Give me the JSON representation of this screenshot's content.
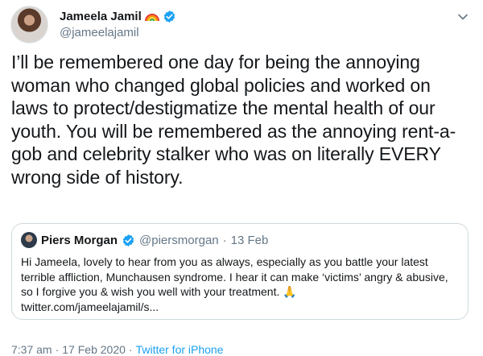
{
  "author": {
    "name": "Jameela Jamil",
    "handle": "@jameelajamil",
    "badge_icon": "rainbow-icon",
    "verified_color": "#1da1f2"
  },
  "tweet": {
    "text": "I’ll be remembered one day for being the annoying woman who changed global policies and worked on laws to protect/destigmatize the mental health of our youth. You will be remembered as the annoying rent-a-gob and celebrity stalker who was on literally EVERY wrong side of history."
  },
  "quoted_tweet": {
    "name": "Piers Morgan",
    "handle": "@piersmorgan",
    "separator": "·",
    "date": "13 Feb",
    "text": "Hi Jameela, lovely to hear from you as always, especially as you battle your latest terrible affliction, Munchausen syndrome. I hear it can make ‘victims’ angry & abusive, so I forgive you & wish you well with your treatment. 🙏",
    "link": "twitter.com/jameelajamil/s..."
  },
  "footer": {
    "time": "7:37 am",
    "separator": "·",
    "date": "17 Feb 2020",
    "source": "Twitter for iPhone"
  }
}
